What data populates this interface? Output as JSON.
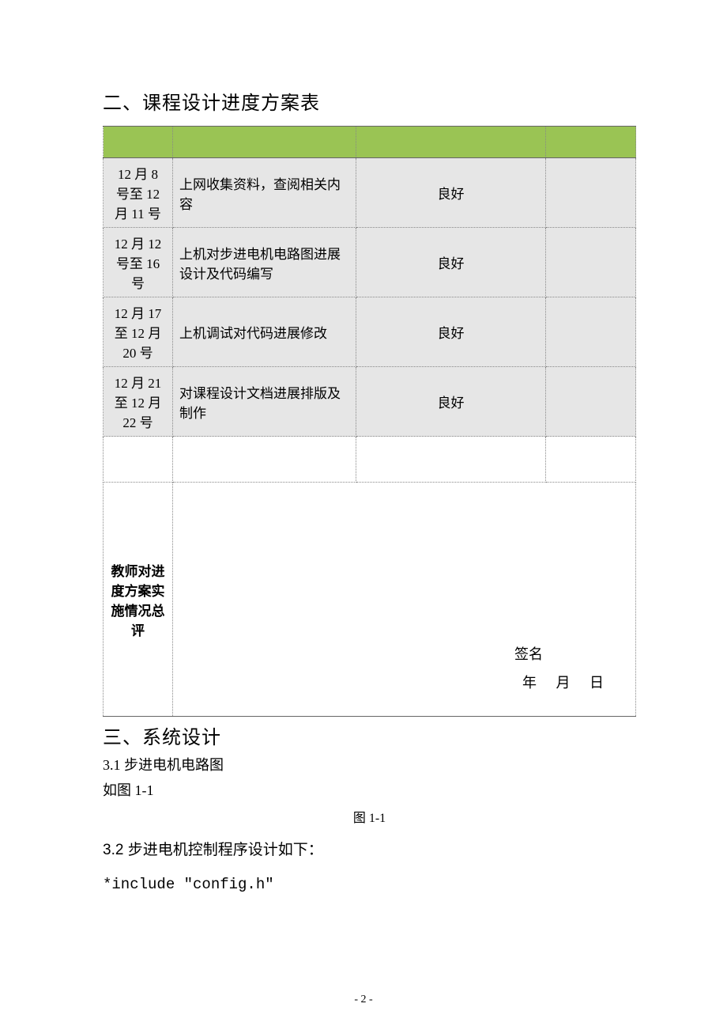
{
  "headings": {
    "section2": "二、课程设计进度方案表",
    "section3": "三、系统设计"
  },
  "table": {
    "rows": [
      {
        "date": "12 月 8 号至 12 月 11 号",
        "task": "上网收集资料，查阅相关内容",
        "rating": "良好",
        "last": ""
      },
      {
        "date": "12 月 12 号至 16 号",
        "task": "上机对步进电机电路图进展设计及代码编写",
        "rating": "良好",
        "last": ""
      },
      {
        "date": "12 月 17 至 12 月 20 号",
        "task": "上机调试对代码进展修改",
        "rating": "良好",
        "last": ""
      },
      {
        "date": "12 月 21 至 12 月 22 号",
        "task": "对课程设计文档进展排版及制作",
        "rating": "良好",
        "last": ""
      }
    ],
    "summary_label": "教师对进度方案实施情况总评",
    "signature_label": "签名",
    "date_parts": {
      "y": "年",
      "m": "月",
      "d": "日"
    }
  },
  "body": {
    "s3_1": "3.1 步进电机电路图",
    "s3_1_fig_intro": "如图 1-1",
    "fig_caption": "图 1-1",
    "s3_2": "3.2 步进电机控制程序设计如下：",
    "code_line": "*include  \"config.h\""
  },
  "page_number": "- 2 -"
}
